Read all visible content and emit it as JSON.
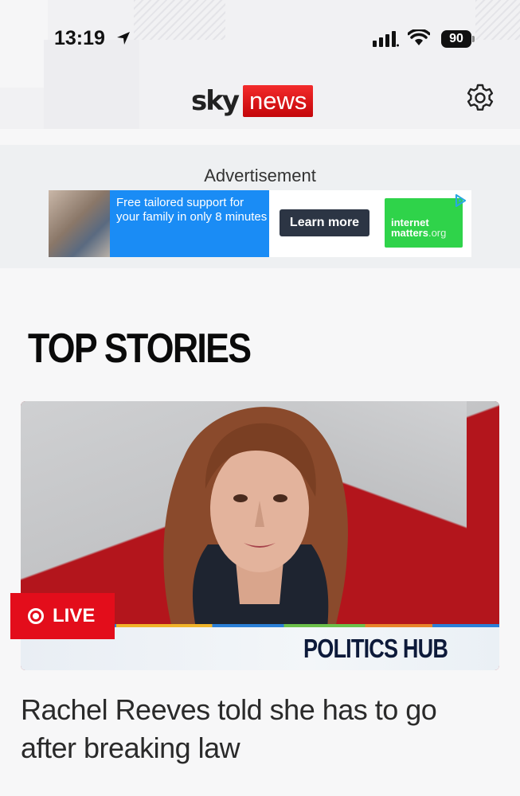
{
  "status_bar": {
    "time": "13:19",
    "battery": "90",
    "icons": [
      "location-arrow-icon",
      "signal-icon",
      "wifi-icon",
      "battery-icon"
    ]
  },
  "header": {
    "logo_sky": "sky",
    "logo_news": "news",
    "settings_icon": "gear-icon",
    "colors": {
      "news_red": "#e10a0f",
      "background": "#f1f1f3"
    }
  },
  "advertisement": {
    "label": "Advertisement",
    "banner_text": "Free tailored support for your family in only 8 minutes",
    "button_label": "Learn more",
    "brand_line1": "internet",
    "brand_line2": "matters",
    "brand_suffix": ".org",
    "colors": {
      "blue": "#1a8cf5",
      "green": "#2fd34a",
      "button": "#2c3544"
    }
  },
  "top_stories": {
    "title": "TOP STORIES",
    "lead_story": {
      "badge": "LIVE",
      "tag": "POLITICS HUB",
      "headline": "Rachel Reeves told she has to go after breaking law",
      "colors": {
        "live_red": "#e30d1b"
      }
    }
  }
}
